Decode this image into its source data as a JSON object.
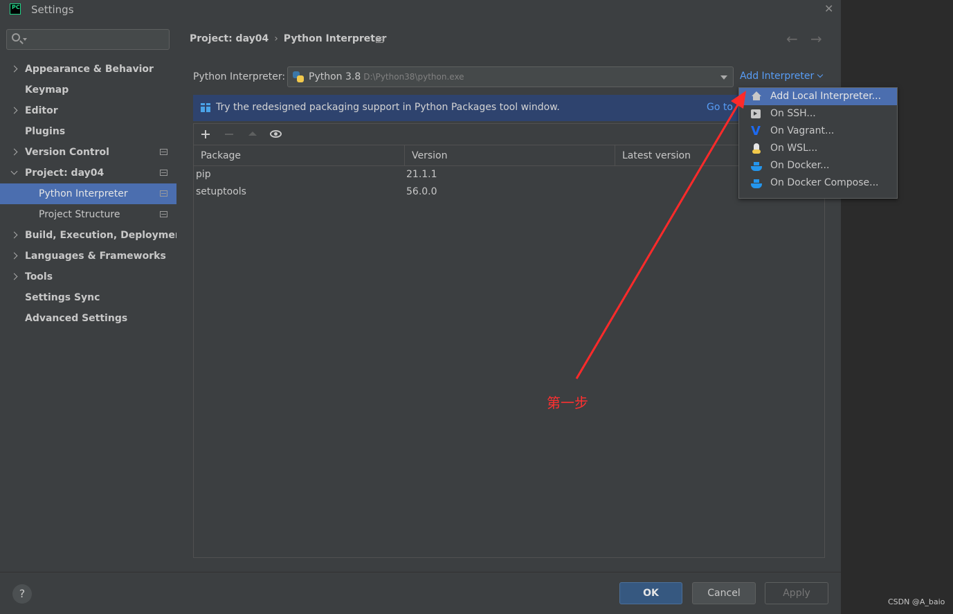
{
  "window": {
    "title": "Settings"
  },
  "sidebar": {
    "search_placeholder": "",
    "items": [
      {
        "label": "Appearance & Behavior"
      },
      {
        "label": "Keymap"
      },
      {
        "label": "Editor"
      },
      {
        "label": "Plugins"
      },
      {
        "label": "Version Control"
      },
      {
        "label": "Project: day04"
      },
      {
        "label": "Python Interpreter"
      },
      {
        "label": "Project Structure"
      },
      {
        "label": "Build, Execution, Deployment"
      },
      {
        "label": "Languages & Frameworks"
      },
      {
        "label": "Tools"
      },
      {
        "label": "Settings Sync"
      },
      {
        "label": "Advanced Settings"
      }
    ]
  },
  "breadcrumb": {
    "project": "Project: day04",
    "separator": "›",
    "page": "Python Interpreter"
  },
  "interpreter": {
    "label": "Python Interpreter:",
    "name": "Python 3.8",
    "path": "D:\\Python38\\python.exe",
    "add_label": "Add Interpreter"
  },
  "banner": {
    "text": "Try the redesigned packaging support in Python Packages tool window.",
    "link": "Go to"
  },
  "table": {
    "headers": [
      "Package",
      "Version",
      "Latest version"
    ],
    "rows": [
      {
        "package": "pip",
        "version": "21.1.1",
        "latest": ""
      },
      {
        "package": "setuptools",
        "version": "56.0.0",
        "latest": ""
      }
    ]
  },
  "popup": {
    "items": [
      {
        "label": "Add Local Interpreter...",
        "icon": "home-icon"
      },
      {
        "label": "On SSH...",
        "icon": "terminal-icon"
      },
      {
        "label": "On Vagrant...",
        "icon": "vagrant-icon"
      },
      {
        "label": "On WSL...",
        "icon": "linux-icon"
      },
      {
        "label": "On Docker...",
        "icon": "docker-icon"
      },
      {
        "label": "On Docker Compose...",
        "icon": "docker-icon"
      }
    ]
  },
  "buttons": {
    "ok": "OK",
    "cancel": "Cancel",
    "apply": "Apply",
    "help": "?"
  },
  "annotation": {
    "text": "第一步",
    "color": "#ff3030"
  },
  "watermark": "CSDN @A_baio",
  "colors": {
    "accent": "#4b6eaf",
    "link": "#589df6",
    "banner_bg": "#2e436e"
  }
}
